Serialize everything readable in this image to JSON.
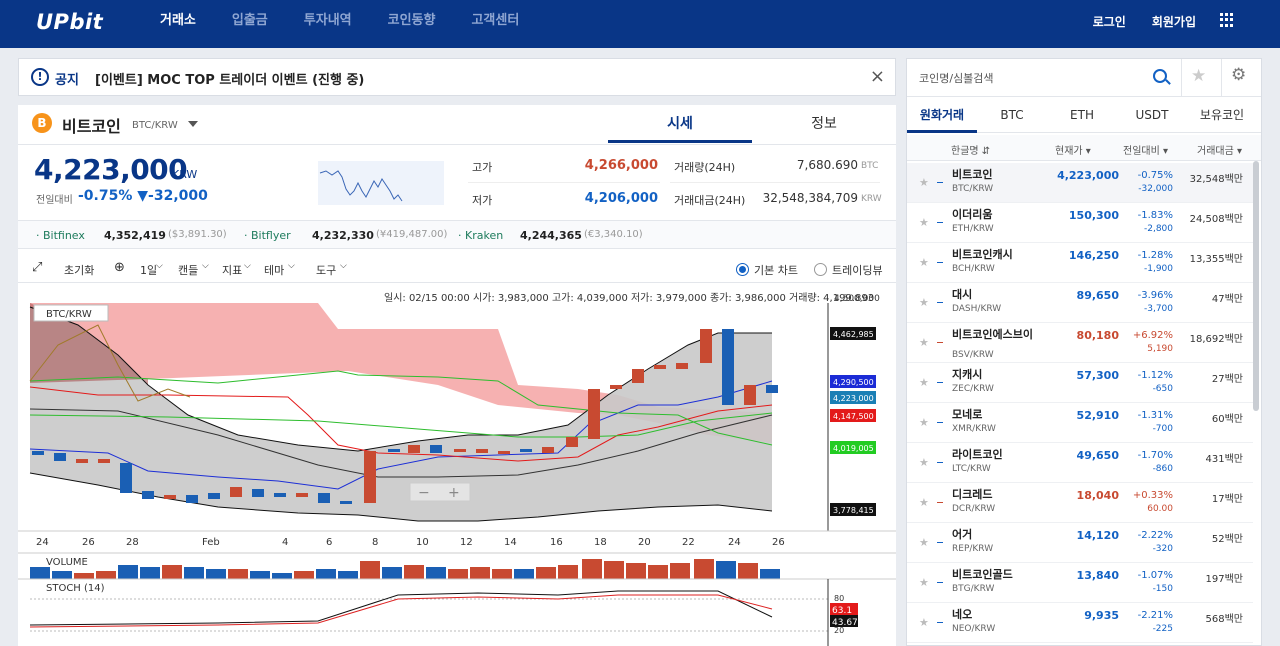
{
  "header": {
    "logo": "UPbit",
    "nav": [
      "거래소",
      "입출금",
      "투자내역",
      "코인동향",
      "고객센터"
    ],
    "login": "로그인",
    "signup": "회원가입"
  },
  "notice": {
    "label": "공지",
    "text": "[이벤트] MOC TOP 트레이더 이벤트 (진행 중)",
    "close": "×"
  },
  "coin": {
    "symbol_letter": "B",
    "name": "비트코인",
    "pair": "BTC/KRW",
    "tab_quote": "시세",
    "tab_info": "정보",
    "price": "4,223,000",
    "unit": "KRW",
    "change_label": "전일대비",
    "change": "-0.75% ▼-32,000",
    "high_label": "고가",
    "high": "4,266,000",
    "low_label": "저가",
    "low": "4,206,000",
    "vol_label": "거래량(24H)",
    "vol": "7,680.690",
    "vol_unit": "BTC",
    "amt_label": "거래대금(24H)",
    "amt": "32,548,384,709",
    "amt_unit": "KRW"
  },
  "exchanges": [
    {
      "name": "· Bitfinex",
      "val": "4,352,419",
      "sub": "($3,891.30)"
    },
    {
      "name": "· Bitflyer",
      "val": "4,232,330",
      "sub": "(¥419,487.00)"
    },
    {
      "name": "· Kraken",
      "val": "4,244,365",
      "sub": "(€3,340.10)"
    }
  ],
  "toolbar": {
    "reset": "초기화",
    "interval": "1일",
    "candle": "캔들",
    "indicator": "지표",
    "theme": "테마",
    "tool": "도구",
    "basic_chart": "기본 차트",
    "tradingview": "트레이딩뷰"
  },
  "chart": {
    "pair_label": "BTC/KRW",
    "ohlc": "일시: 02/15 00:00  시가: 3,983,000  고가: 4,039,000  저가: 3,979,000  종가: 3,986,000  거래량: 4,199.893",
    "x_ticks": [
      "24",
      "26",
      "28",
      "Feb",
      "4",
      "6",
      "8",
      "10",
      "12",
      "14",
      "16",
      "18",
      "20",
      "22",
      "24",
      "26"
    ],
    "y_top": "4,500,000",
    "price_tags": [
      {
        "text": "4,462,985",
        "color": "#111111"
      },
      {
        "text": "4,290,500",
        "color": "#1b2bd6"
      },
      {
        "text": "4,223,000",
        "color": "#1a7fb5"
      },
      {
        "text": "4,147,500",
        "color": "#e31a1a"
      },
      {
        "text": "4,019,005",
        "color": "#22cc22"
      },
      {
        "text": "3,778,415",
        "color": "#111111"
      }
    ],
    "volume_label": "VOLUME",
    "stoch_label": "STOCH (14)",
    "stoch_ticks": [
      "80",
      "20"
    ],
    "stoch_tags": [
      "63.1",
      "43.67"
    ]
  },
  "market": {
    "search_placeholder": "코인명/심볼검색",
    "tabs": [
      "원화거래",
      "BTC",
      "ETH",
      "USDT",
      "보유코인"
    ],
    "columns": [
      "한글명 ⇵",
      "현재가 ▾",
      "전일대비 ▾",
      "거래대금 ▾"
    ],
    "rows": [
      {
        "name": "비트코인",
        "sym": "BTC/KRW",
        "price": "4,223,000",
        "pct": "-0.75%",
        "amt": "-32,000",
        "vol": "32,548백만",
        "dir": "down"
      },
      {
        "name": "이더리움",
        "sym": "ETH/KRW",
        "price": "150,300",
        "pct": "-1.83%",
        "amt": "-2,800",
        "vol": "24,508백만",
        "dir": "down"
      },
      {
        "name": "비트코인캐시",
        "sym": "BCH/KRW",
        "price": "146,250",
        "pct": "-1.28%",
        "amt": "-1,900",
        "vol": "13,355백만",
        "dir": "down"
      },
      {
        "name": "대시",
        "sym": "DASH/KRW",
        "price": "89,650",
        "pct": "-3.96%",
        "amt": "-3,700",
        "vol": "47백만",
        "dir": "down"
      },
      {
        "name": "비트코인에스브이",
        "sym": "BSV/KRW",
        "price": "80,180",
        "pct": "+6.92%",
        "amt": "5,190",
        "vol": "18,692백만",
        "dir": "up"
      },
      {
        "name": "지캐시",
        "sym": "ZEC/KRW",
        "price": "57,300",
        "pct": "-1.12%",
        "amt": "-650",
        "vol": "27백만",
        "dir": "down"
      },
      {
        "name": "모네로",
        "sym": "XMR/KRW",
        "price": "52,910",
        "pct": "-1.31%",
        "amt": "-700",
        "vol": "60백만",
        "dir": "down"
      },
      {
        "name": "라이트코인",
        "sym": "LTC/KRW",
        "price": "49,650",
        "pct": "-1.70%",
        "amt": "-860",
        "vol": "431백만",
        "dir": "down"
      },
      {
        "name": "디크레드",
        "sym": "DCR/KRW",
        "price": "18,040",
        "pct": "+0.33%",
        "amt": "60.00",
        "vol": "17백만",
        "dir": "up"
      },
      {
        "name": "어거",
        "sym": "REP/KRW",
        "price": "14,120",
        "pct": "-2.22%",
        "amt": "-320",
        "vol": "52백만",
        "dir": "down"
      },
      {
        "name": "비트코인골드",
        "sym": "BTG/KRW",
        "price": "13,840",
        "pct": "-1.07%",
        "amt": "-150",
        "vol": "197백만",
        "dir": "down"
      },
      {
        "name": "네오",
        "sym": "NEO/KRW",
        "price": "9,935",
        "pct": "-2.21%",
        "amt": "-225",
        "vol": "568백만",
        "dir": "down"
      }
    ]
  },
  "colors": {
    "brand": "#093687",
    "up": "#c84a31",
    "down": "#1261c4"
  }
}
